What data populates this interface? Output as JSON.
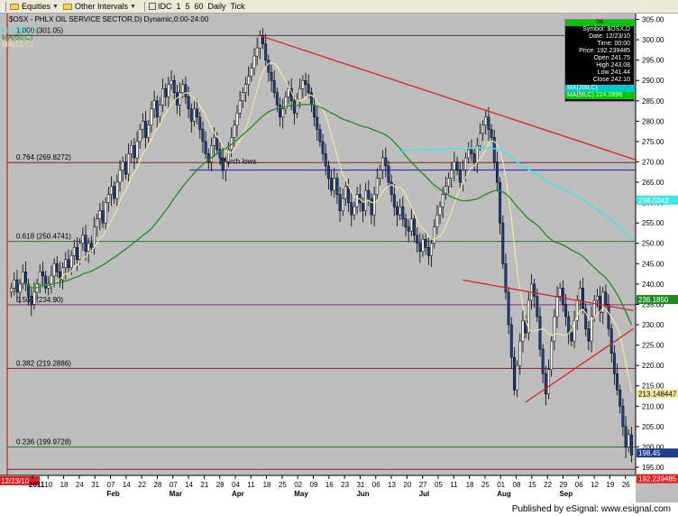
{
  "toolbar": {
    "equities": "Equities",
    "other_intervals": "Other Intervals",
    "intervals": [
      "IDC",
      "1",
      "5",
      "60",
      "Daily",
      "Tick"
    ]
  },
  "chart_title": "$OSX - PHLX OIL SERVICE SECTOR,D) Dynamic,0:00-24:00",
  "footer": "Published by eSignal: www.esignal.com",
  "legend": {
    "ma_a": "MA(200,C)",
    "ma_b": "MA(50,C)",
    "ma_c": "MA(10,C)"
  },
  "info_box": {
    "header": "OK",
    "lines": [
      "Symbol: $OSX,D",
      "Date: 12/23/10",
      "Time: 00:00",
      "Price: 192.239485",
      "Open 241.75",
      "High 243.08",
      "Low 241.44",
      "Close 242.10"
    ],
    "ma_lines": [
      "MA(200,C)",
      "MA(50,C) 224.2896"
    ]
  },
  "colors": {
    "background": "#bdbdbd",
    "candles": "#1e3f8c",
    "ma10": "#f2eaa0",
    "ma50": "#1f8c1f",
    "ma200": "#3ee6e6",
    "trendline": "#e02020",
    "support": "#3b3bb0"
  },
  "chart_data": {
    "type": "candlestick",
    "x_labels": [
      "2011",
      "10",
      "18",
      "24",
      "31",
      "07",
      "14",
      "22",
      "28",
      "07",
      "14",
      "21",
      "28",
      "04",
      "11",
      "18",
      "25",
      "02",
      "09",
      "16",
      "23",
      "31",
      "06",
      "13",
      "20",
      "27",
      "05",
      "11",
      "18",
      "25",
      "01",
      "08",
      "15",
      "22",
      "29",
      "06",
      "12",
      "19",
      "26"
    ],
    "months": [
      {
        "label": "Feb"
      },
      {
        "label": "Mar"
      },
      {
        "label": "Apr"
      },
      {
        "label": "May"
      },
      {
        "label": "Jun"
      },
      {
        "label": "Jul"
      },
      {
        "label": "Aug"
      },
      {
        "label": "Sep"
      }
    ],
    "first_date_label": "12/23/10",
    "y_axis": {
      "min": 193,
      "max": 306,
      "ticks": [
        305,
        300,
        295,
        290,
        285,
        280,
        275,
        270,
        265,
        260,
        255,
        250,
        245,
        240,
        235,
        230,
        225,
        220,
        215,
        210,
        205,
        200,
        195
      ]
    },
    "fib_levels": [
      {
        "label": "1.000 (301.05)",
        "value": 301.05,
        "color": "#404040"
      },
      {
        "label": "0.764 (269.8272)",
        "value": 269.83,
        "color": "#8b2020"
      },
      {
        "label": "0.618 (250.4741)",
        "value": 250.47,
        "color": "#2a7a2a"
      },
      {
        "label": "0.500 (234.90)",
        "value": 234.9,
        "color": "#8a2a8a"
      },
      {
        "label": "0.382 (219.2886)",
        "value": 219.29,
        "color": "#8b2020"
      },
      {
        "label": "0.236 (199.9728)",
        "value": 199.97,
        "color": "#2a7a2a"
      },
      {
        "label": "",
        "value": 194.5,
        "color": "#8b2020"
      }
    ],
    "annotation": "March lows",
    "support_value": 268.0,
    "price_tags": [
      {
        "label": "268.0343",
        "value": 260.6,
        "color": "#3ee6e6",
        "text_color": "#ffffff"
      },
      {
        "label": "236.1850",
        "value": 236.2,
        "color": "#1f8c1f",
        "text_color": "#ffffff"
      },
      {
        "label": "213.148447",
        "value": 213.1,
        "color": "#f2eaa0",
        "text_color": "#000000"
      },
      {
        "label": "198.45",
        "value": 198.5,
        "color": "#1e3f8c",
        "text_color": "#ffffff"
      },
      {
        "label": "192.239485",
        "value": 192.2,
        "color": "#e02020",
        "text_color": "#ffffff"
      }
    ],
    "closes": [
      239,
      241,
      238,
      240,
      243,
      240,
      237,
      235,
      238,
      240,
      243,
      242,
      239,
      240,
      242,
      245,
      243,
      241,
      244,
      246,
      244,
      247,
      249,
      246,
      250,
      252,
      248,
      250,
      249,
      254,
      256,
      258,
      255,
      260,
      262,
      264,
      261,
      265,
      268,
      270,
      267,
      272,
      274,
      271,
      275,
      278,
      280,
      276,
      279,
      283,
      285,
      281,
      284,
      288,
      286,
      289,
      290,
      287,
      284,
      287,
      289,
      286,
      283,
      280,
      283,
      281,
      278,
      275,
      272,
      270,
      274,
      276,
      273,
      271,
      268,
      270,
      273,
      276,
      279,
      282,
      285,
      287,
      289,
      291,
      293,
      296,
      298,
      301,
      299,
      295,
      292,
      290,
      287,
      284,
      281,
      283,
      286,
      288,
      285,
      282,
      285,
      288,
      290,
      289,
      287,
      284,
      281,
      278,
      275,
      272,
      269,
      266,
      263,
      266,
      262,
      258,
      261,
      264,
      260,
      257,
      259,
      262,
      260,
      258,
      263,
      261,
      257,
      262,
      266,
      268,
      271,
      269,
      265,
      262,
      259,
      257,
      259,
      256,
      254,
      253,
      256,
      252,
      250,
      248,
      251,
      249,
      247,
      250,
      254,
      257,
      259,
      262,
      264,
      266,
      268,
      270,
      268,
      265,
      268,
      271,
      273,
      272,
      270,
      274,
      277,
      279,
      281,
      278,
      276,
      270,
      265,
      255,
      245,
      238,
      230,
      222,
      214,
      220,
      226,
      231,
      228,
      236,
      240,
      237,
      232,
      224,
      218,
      213,
      219,
      226,
      232,
      237,
      239,
      235,
      232,
      228,
      226,
      231,
      236,
      239,
      234,
      229,
      226,
      232,
      236,
      237,
      233,
      238,
      235,
      229,
      223,
      218,
      214,
      210,
      205,
      200,
      203,
      198
    ]
  }
}
